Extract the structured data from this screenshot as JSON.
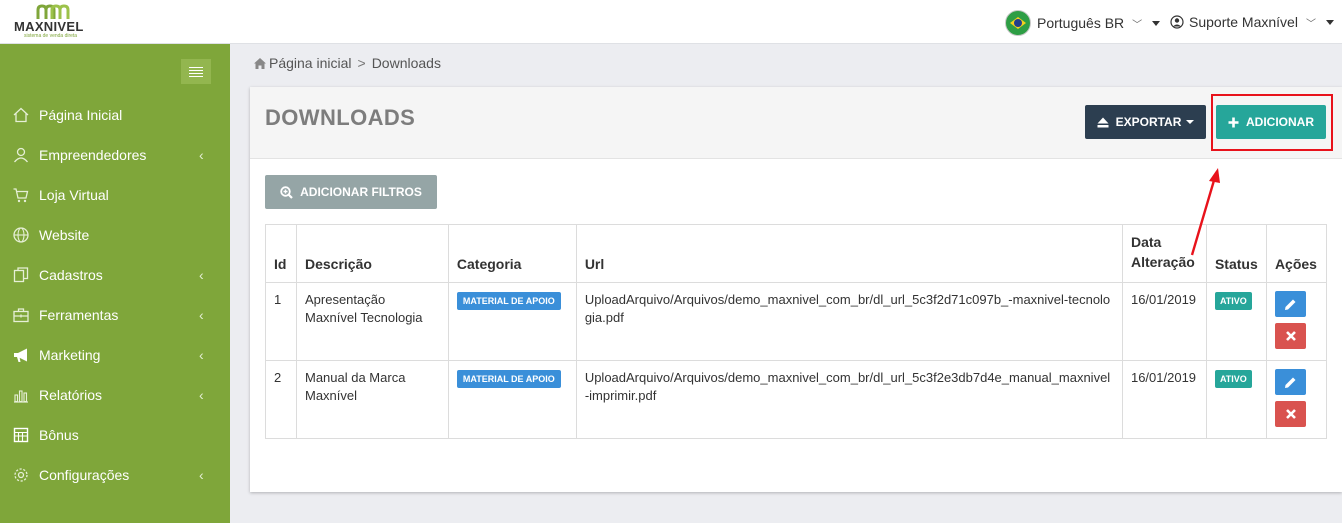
{
  "brand": {
    "name": "MAXNIVEL",
    "tagline": "sistema de venda direta",
    "color": "#7fa63a"
  },
  "header": {
    "language": "Português BR",
    "user": "Suporte Maxnível"
  },
  "sidebar": {
    "items": [
      {
        "label": "Página Inicial",
        "icon": "home-icon",
        "arrow": ""
      },
      {
        "label": "Empreendedores",
        "icon": "user-icon",
        "arrow": "‹"
      },
      {
        "label": "Loja Virtual",
        "icon": "cart-icon",
        "arrow": ""
      },
      {
        "label": "Website",
        "icon": "globe-icon",
        "arrow": ""
      },
      {
        "label": "Cadastros",
        "icon": "copy-icon",
        "arrow": "‹"
      },
      {
        "label": "Ferramentas",
        "icon": "toolbox-icon",
        "arrow": "‹"
      },
      {
        "label": "Marketing",
        "icon": "bullhorn-icon",
        "arrow": "‹"
      },
      {
        "label": "Relatórios",
        "icon": "bar-chart-icon",
        "arrow": "‹"
      },
      {
        "label": "Bônus",
        "icon": "calculator-icon",
        "arrow": ""
      },
      {
        "label": "Configurações",
        "icon": "gear-icon",
        "arrow": "‹"
      }
    ]
  },
  "breadcrumb": {
    "home": "Página inicial",
    "separator": ">",
    "current": "Downloads"
  },
  "page": {
    "title": "DOWNLOADS",
    "export_label": "EXPORTAR",
    "add_label": "ADICIONAR",
    "filter_label": "ADICIONAR FILTROS"
  },
  "table": {
    "columns": {
      "id": "Id",
      "descricao": "Descrição",
      "categoria": "Categoria",
      "url": "Url",
      "data_line1": "Data",
      "data_line2": "Alteração",
      "status": "Status",
      "acoes": "Ações"
    },
    "rows": [
      {
        "id": "1",
        "descricao": "Apresentação Maxnível Tecnologia",
        "categoria": "MATERIAL DE APOIO",
        "url": "UploadArquivo/Arquivos/demo_maxnivel_com_br/dl_url_5c3f2d71c097b_-maxnivel-tecnologia.pdf",
        "data": "16/01/2019",
        "status": "ATIVO"
      },
      {
        "id": "2",
        "descricao": "Manual da Marca Maxnível",
        "categoria": "MATERIAL DE APOIO",
        "url": "UploadArquivo/Arquivos/demo_maxnivel_com_br/dl_url_5c3f2e3db7d4e_manual_maxnivel-imprimir.pdf",
        "data": "16/01/2019",
        "status": "ATIVO"
      }
    ]
  },
  "colors": {
    "sidebar": "#7fa63a",
    "primary_dark": "#2c3e50",
    "teal": "#26a69a",
    "blue": "#3a8fd9",
    "red": "#d9534f",
    "highlight": "#e8121b"
  }
}
